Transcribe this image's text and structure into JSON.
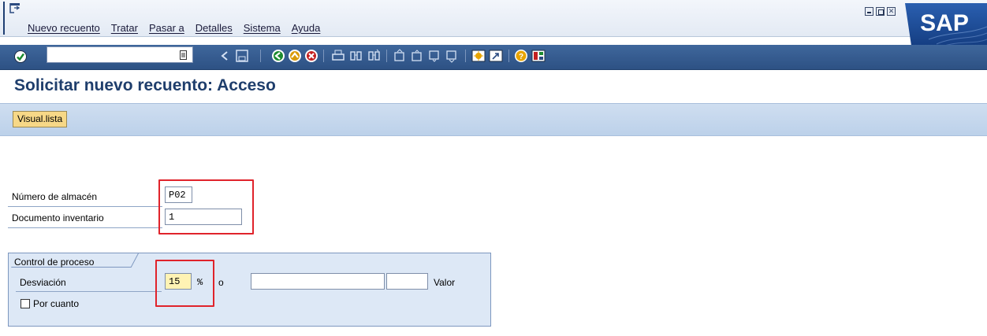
{
  "menu": {
    "items": [
      "Nuevo recuento",
      "Tratar",
      "Pasar a",
      "Detalles",
      "Sistema",
      "Ayuda"
    ]
  },
  "window": {
    "logo_text": "SAP"
  },
  "toolbar": {
    "command_field_value": "",
    "icons": [
      "ok-icon",
      "back-icon",
      "save-icon",
      "back-nav-icon",
      "exit-icon",
      "cancel-icon",
      "print-icon",
      "find-icon",
      "find-next-icon",
      "first-page-icon",
      "prev-page-icon",
      "next-page-icon",
      "last-page-icon",
      "new-session-icon",
      "shortcut-icon",
      "help-icon",
      "layout-icon"
    ]
  },
  "page": {
    "title": "Solicitar nuevo recuento: Acceso"
  },
  "app_toolbar": {
    "visual_lista_label": "Visual.lista"
  },
  "fields": {
    "almacen_label": "Número de almacén",
    "almacen_value": "P02",
    "documento_label": "Documento inventario",
    "documento_value": "1"
  },
  "process_control": {
    "frame_title": "Control de proceso",
    "desviacion_label": "Desviación",
    "desviacion_value": "15",
    "percent_sign": "%",
    "o_label": "o",
    "valor_label": "Valor",
    "valor_field_value": "",
    "valor_unit_value": "",
    "por_cuanto_label": "Por cuanto",
    "por_cuanto_checked": false
  },
  "colors": {
    "highlight_box": "#e0232b",
    "title": "#1f3e6c",
    "button": "#f7d887"
  }
}
